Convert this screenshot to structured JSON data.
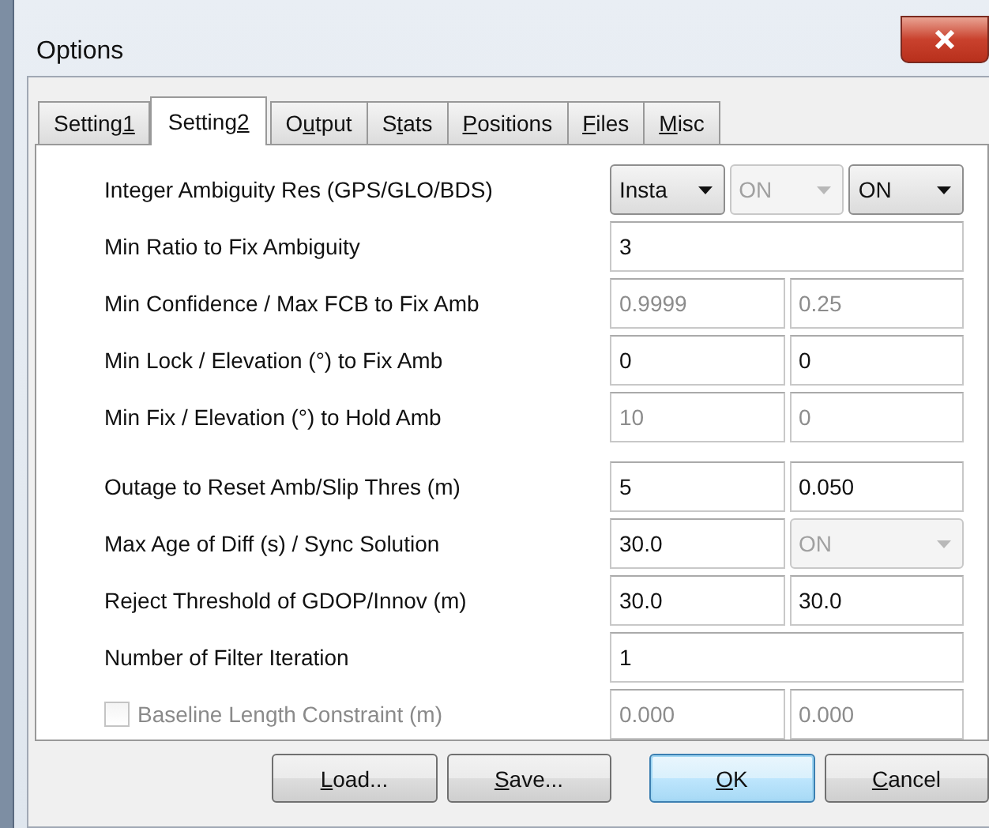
{
  "window": {
    "title": "Options"
  },
  "tabs": [
    {
      "label_parts": {
        "before": "Setting",
        "key": "1"
      },
      "selected": false
    },
    {
      "label_parts": {
        "before": "Setting",
        "key": "2"
      },
      "selected": true
    },
    {
      "label_parts": {
        "before": "O",
        "key": "u",
        "after": "tput"
      },
      "selected": false
    },
    {
      "label_parts": {
        "before": "S",
        "key": "t",
        "after": "ats"
      },
      "selected": false
    },
    {
      "label_parts": {
        "key": "P",
        "after": "ositions"
      },
      "selected": false
    },
    {
      "label_parts": {
        "key": "F",
        "after": "iles"
      },
      "selected": false
    },
    {
      "label_parts": {
        "key": "M",
        "after": "isc"
      },
      "selected": false
    }
  ],
  "groups": [
    [
      {
        "label": "Integer Ambiguity Res (GPS/GLO/BDS)",
        "disabled": false,
        "fields": [
          {
            "kind": "select",
            "value": "Insta",
            "disabled": false
          },
          {
            "kind": "select",
            "value": "ON",
            "disabled": true
          },
          {
            "kind": "select",
            "value": "ON",
            "disabled": false
          }
        ]
      },
      {
        "label": "Min Ratio to Fix Ambiguity",
        "disabled": false,
        "fields": [
          {
            "kind": "text",
            "value": "3",
            "disabled": false
          }
        ]
      },
      {
        "label": "Min Confidence / Max FCB to Fix Amb",
        "disabled": false,
        "fields": [
          {
            "kind": "text",
            "value": "0.9999",
            "disabled": true
          },
          {
            "kind": "text",
            "value": "0.25",
            "disabled": true
          }
        ]
      },
      {
        "label": "Min Lock / Elevation (°) to Fix Amb",
        "disabled": false,
        "fields": [
          {
            "kind": "text",
            "value": "0",
            "disabled": false
          },
          {
            "kind": "text",
            "value": "0",
            "disabled": false
          }
        ]
      },
      {
        "label": "Min Fix / Elevation (°) to Hold Amb",
        "disabled": false,
        "fields": [
          {
            "kind": "text",
            "value": "10",
            "disabled": true
          },
          {
            "kind": "text",
            "value": "0",
            "disabled": true
          }
        ]
      }
    ],
    [
      {
        "label": "Outage to Reset Amb/Slip Thres (m)",
        "disabled": false,
        "fields": [
          {
            "kind": "text",
            "value": "5",
            "disabled": false
          },
          {
            "kind": "text",
            "value": "0.050",
            "disabled": false
          }
        ]
      },
      {
        "label": "Max Age of Diff (s) / Sync Solution",
        "disabled": false,
        "fields": [
          {
            "kind": "text",
            "value": "30.0",
            "disabled": false
          },
          {
            "kind": "select",
            "value": "ON",
            "disabled": true
          }
        ]
      },
      {
        "label": "Reject Threshold of GDOP/Innov (m)",
        "disabled": false,
        "fields": [
          {
            "kind": "text",
            "value": "30.0",
            "disabled": false
          },
          {
            "kind": "text",
            "value": "30.0",
            "disabled": false
          }
        ]
      },
      {
        "label": "Number of Filter Iteration",
        "disabled": false,
        "fields": [
          {
            "kind": "text",
            "value": "1",
            "disabled": false
          }
        ]
      },
      {
        "label": "Baseline Length Constraint (m)",
        "disabled": true,
        "checkbox": {
          "checked": false,
          "disabled": true
        },
        "fields": [
          {
            "kind": "text",
            "value": "0.000",
            "disabled": true
          },
          {
            "kind": "text",
            "value": "0.000",
            "disabled": true
          }
        ]
      }
    ]
  ],
  "buttons": [
    {
      "label_parts": {
        "key": "L",
        "after": "oad..."
      },
      "default": false
    },
    {
      "label_parts": {
        "key": "S",
        "after": "ave..."
      },
      "default": false
    },
    {
      "label_parts": {
        "key": "O",
        "after": "K"
      },
      "default": true
    },
    {
      "label_parts": {
        "key": "C",
        "after": "ancel"
      },
      "default": false
    }
  ]
}
